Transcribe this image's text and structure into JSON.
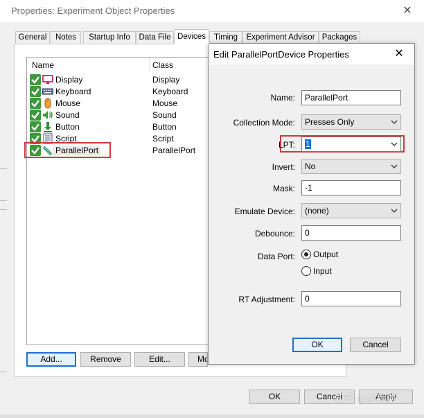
{
  "outer_window": {
    "title": "Properties: Experiment Object Properties",
    "close_glyph": "✕"
  },
  "tabs": [
    {
      "label": "General"
    },
    {
      "label": "Notes"
    },
    {
      "label": "Startup Info"
    },
    {
      "label": "Data File"
    },
    {
      "label": "Devices"
    },
    {
      "label": "Timing"
    },
    {
      "label": "Experiment Advisor"
    },
    {
      "label": "Packages"
    }
  ],
  "device_list": {
    "columns": [
      "Name",
      "Class"
    ],
    "rows": [
      {
        "name": "Display",
        "class": "Display",
        "icon": "display-icon"
      },
      {
        "name": "Keyboard",
        "class": "Keyboard",
        "icon": "keyboard-icon"
      },
      {
        "name": "Mouse",
        "class": "Mouse",
        "icon": "mouse-icon"
      },
      {
        "name": "Sound",
        "class": "Sound",
        "icon": "sound-icon"
      },
      {
        "name": "Button",
        "class": "Button",
        "icon": "button-icon"
      },
      {
        "name": "Script",
        "class": "Script",
        "icon": "script-icon"
      },
      {
        "name": "ParallelPort",
        "class": "ParallelPort",
        "icon": "parallel-port-icon"
      }
    ]
  },
  "panel_buttons": {
    "add": "Add...",
    "remove": "Remove",
    "edit": "Edit...",
    "more": "Mo"
  },
  "outer_buttons": {
    "ok": "OK",
    "cancel": "Cancel",
    "apply": "Apply"
  },
  "dialog": {
    "title": "Edit ParallelPortDevice Properties",
    "close_glyph": "✕",
    "fields": {
      "name_label": "Name:",
      "name_value": "ParallelPort",
      "collection_mode_label": "Collection Mode:",
      "collection_mode_value": "Presses Only",
      "lpt_label": "LPT:",
      "lpt_value": "1",
      "invert_label": "Invert:",
      "invert_value": "No",
      "mask_label": "Mask:",
      "mask_value": "-1",
      "emulate_device_label": "Emulate Device:",
      "emulate_device_value": "(none)",
      "debounce_label": "Debounce:",
      "debounce_value": "0",
      "data_port_label": "Data Port:",
      "data_port_output": "Output",
      "data_port_input": "Input",
      "data_port_selected": "Output",
      "rt_adjustment_label": "RT Adjustment:",
      "rt_adjustment_value": "0"
    },
    "ok": "OK",
    "cancel": "Cancel"
  },
  "watermark": "知乎 @花秋脑",
  "colors": {
    "highlight_border": "#d2383d",
    "check_green": "#3d9a3a",
    "default_button_border": "#1f6fd2"
  }
}
